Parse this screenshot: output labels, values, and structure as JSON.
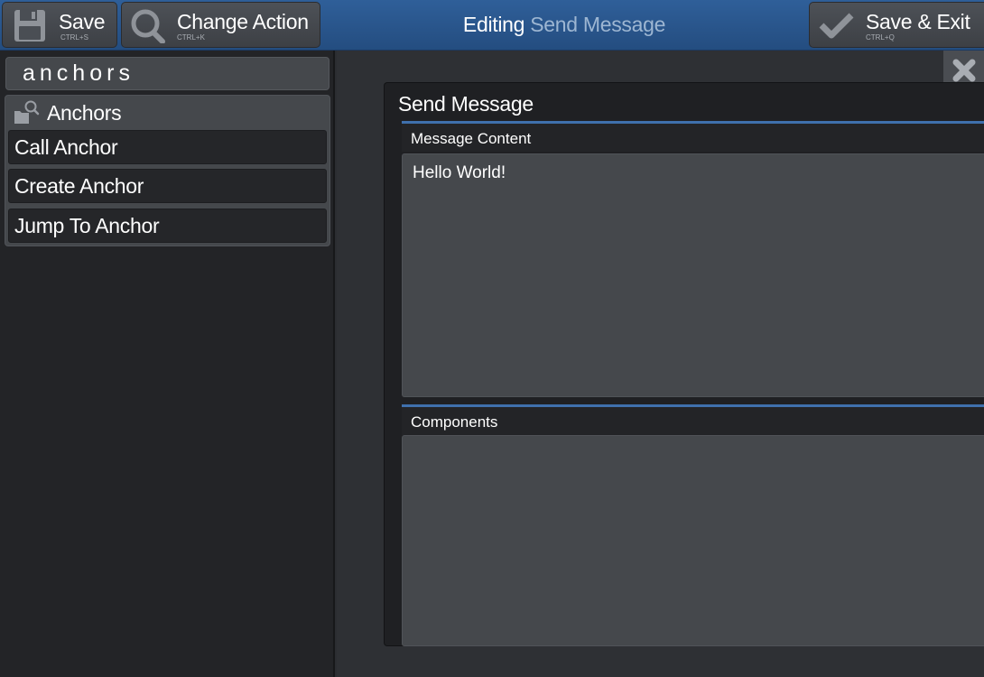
{
  "toolbar": {
    "save": {
      "label": "Save",
      "shortcut": "CTRL+S",
      "icon": "floppy-disk-icon"
    },
    "change_action": {
      "label": "Change Action",
      "shortcut": "CTRL+K",
      "icon": "magnifier-icon"
    },
    "title_prefix": "Editing",
    "title_action": "Send Message",
    "save_exit": {
      "label": "Save & Exit",
      "shortcut": "CTRL+Q",
      "icon": "checkmark-icon"
    }
  },
  "sidebar": {
    "search_value": "anchors",
    "group": {
      "label": "Anchors",
      "icon": "folder-search-icon",
      "items": [
        {
          "label": "Call Anchor"
        },
        {
          "label": "Create Anchor"
        },
        {
          "label": "Jump To Anchor"
        }
      ]
    }
  },
  "main": {
    "close_icon": "close-x-icon",
    "panel_title": "Send Message",
    "fields": [
      {
        "label": "Message Content",
        "value": "Hello World!"
      },
      {
        "label": "Components",
        "value": ""
      }
    ]
  },
  "colors": {
    "toolbar_blue": "#2a568c",
    "title_accent": "#9db6d2",
    "field_accent": "#3f70ad",
    "panel_bg": "#1f2023",
    "input_bg": "#45484c"
  }
}
